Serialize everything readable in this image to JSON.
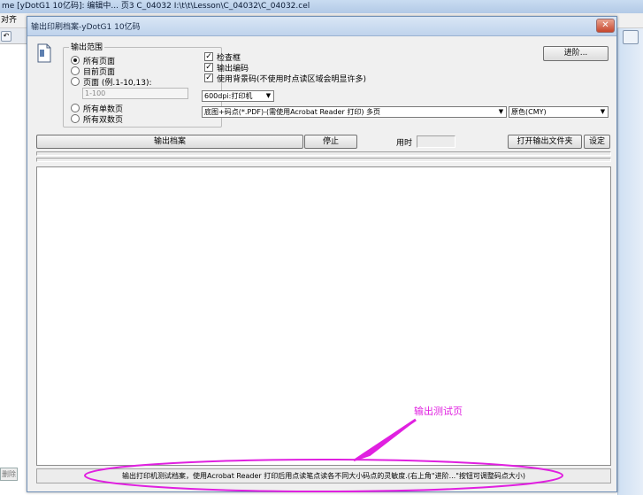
{
  "bg": {
    "title": "me [yDotG1 10亿码]: 编辑中... 页3   C_04032 I:\\t\\t\\Lesson\\C_04032\\C_04032.cel",
    "menu": "对齐",
    "left_button": "删除"
  },
  "dialog": {
    "title": "输出印刷档案-yDotG1 10亿码",
    "close": "✕",
    "range_group": {
      "legend": "输出范围",
      "options": [
        "所有页面",
        "目前页面",
        "页面  (例.1-10,13):",
        "所有单数页",
        "所有双数页"
      ],
      "selected": "所有页面",
      "range_placeholder": "1-100"
    },
    "checkboxes": [
      {
        "label": "检查框",
        "checked": true
      },
      {
        "label": "输出编码",
        "checked": true
      },
      {
        "label": "使用背景码(不使用时点读区域会明显许多)",
        "checked": true
      }
    ],
    "dpi_select": "600dpi:打印机",
    "mode_select": "底图+码点(*.PDF)-(需使用Acrobat Reader 打印) 多页",
    "color_select": "原色(CMY)",
    "advanced_button": "进阶...",
    "output_button": "输出档案",
    "stop_button": "停止",
    "time_label": "用时",
    "open_folder_button": "打开输出文件夹",
    "settings_button": "设定",
    "status_text": "输出打印机测试档案，使用Acrobat Reader 打印后用点读笔点读各不同大小码点的灵敏度.(右上角\"进阶...\"按钮可调整码点大小)"
  },
  "annotation": {
    "text": "输出测试页",
    "color": "#e020e0"
  }
}
